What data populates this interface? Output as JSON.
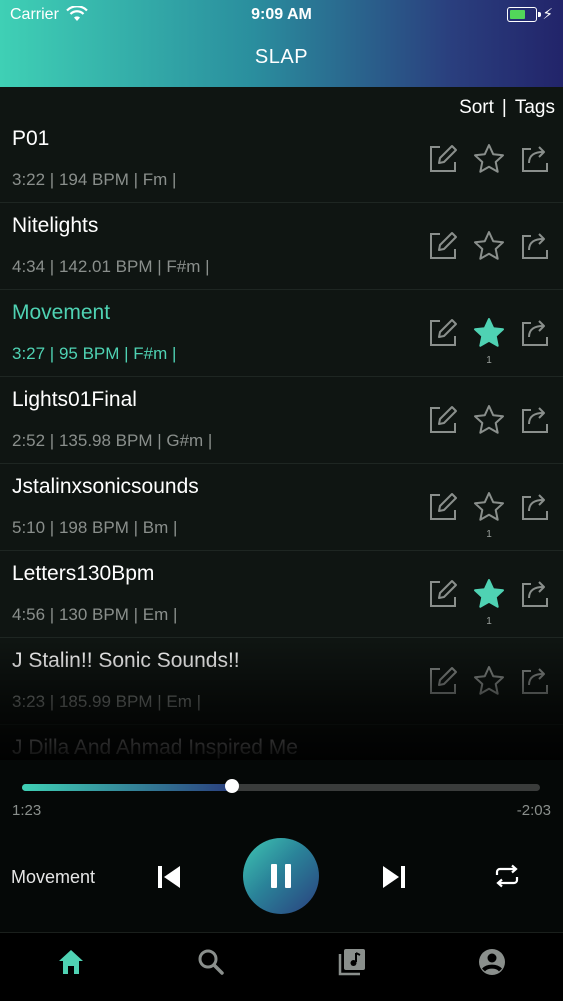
{
  "status_bar": {
    "carrier": "Carrier",
    "time": "9:09 AM"
  },
  "app": {
    "title": "SLAP"
  },
  "toolbar": {
    "sort_label": "Sort",
    "separator": "|",
    "tags_label": "Tags"
  },
  "songs": [
    {
      "name": "P01",
      "meta": "3:22 | 194 BPM | Fm |",
      "starred": false,
      "count": ""
    },
    {
      "name": "Nitelights",
      "meta": "4:34 | 142.01 BPM | F#m |",
      "starred": false,
      "count": ""
    },
    {
      "name": "Movement",
      "meta": "3:27 | 95 BPM | F#m |",
      "starred": true,
      "count": "1",
      "active": true
    },
    {
      "name": "Lights01Final",
      "meta": "2:52 | 135.98 BPM | G#m |",
      "starred": false,
      "count": ""
    },
    {
      "name": "Jstalinxsonicsounds",
      "meta": "5:10 | 198 BPM | Bm |",
      "starred": false,
      "count": "1"
    },
    {
      "name": "Letters130Bpm",
      "meta": "4:56 | 130 BPM | Em |",
      "starred": true,
      "count": "1"
    },
    {
      "name": "J Stalin!! Sonic Sounds!!",
      "meta": "3:23 | 185.99 BPM | Em |",
      "starred": false,
      "count": ""
    },
    {
      "name": "J Dilla And Ahmad Inspired Me",
      "meta": "",
      "starred": false,
      "count": ""
    }
  ],
  "player": {
    "elapsed": "1:23",
    "remaining": "-2:03",
    "progress_fraction": 0.405,
    "now_playing": "Movement"
  },
  "colors": {
    "accent": "#4fd2b3",
    "star_filled": "#4fd2b3",
    "icon_gray": "#8a8f8c"
  },
  "tabs": [
    "home-icon",
    "search-icon",
    "library-icon",
    "profile-icon"
  ]
}
